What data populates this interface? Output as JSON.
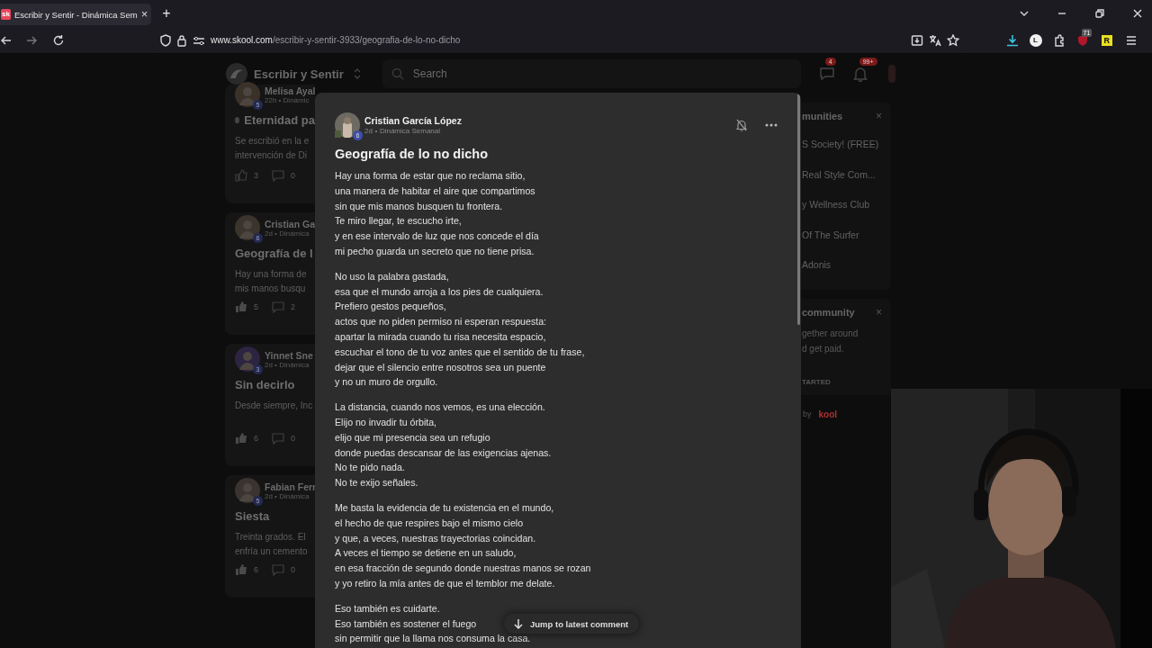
{
  "browser": {
    "tab": {
      "favicon": "sk",
      "title": "Escribir y Sentir - Dinámica Sem",
      "close": "×"
    },
    "new_tab": "+",
    "url": {
      "host": "www.skool.com",
      "path": "/escribir-y-sentir-3933/geografia-de-lo-no-dicho"
    },
    "extension_badge": "71",
    "extension_letter": "R",
    "profile_letter": "L"
  },
  "header": {
    "community": "Escribir y Sentir",
    "search_placeholder": "Search",
    "chat_badge": "4",
    "notification_badge": "99+"
  },
  "feed": [
    {
      "author": "Melisa Ayal",
      "level": "5",
      "meta": "22h • Dinámic",
      "pinned": true,
      "title": "Eternidad pa",
      "excerpt": [
        "Se escribió en la e",
        "intervención de Di"
      ],
      "likes": "3",
      "comments": "0",
      "liked": false
    },
    {
      "author": "Cristian Ga",
      "level": "6",
      "meta": "2d • Dinámica",
      "pinned": false,
      "title": "Geografía de l",
      "excerpt": [
        "Hay una forma de",
        "mis manos busqu"
      ],
      "likes": "5",
      "comments": "2",
      "liked": true
    },
    {
      "author": "Yinnet Sne",
      "level": "3",
      "meta": "2d • Dinámica",
      "pinned": false,
      "title": "Sin decirlo",
      "excerpt": [
        "Desde siempre, Inc"
      ],
      "likes": "6",
      "comments": "0",
      "liked": true
    },
    {
      "author": "Fabian Ferr",
      "level": "5",
      "meta": "2d • Dinámica",
      "pinned": false,
      "title": "Siesta",
      "excerpt": [
        "Treinta grados. El",
        "enfría un cemento"
      ],
      "likes": "6",
      "comments": "0",
      "liked": true
    }
  ],
  "sidebar": [
    {
      "title": "munities",
      "close": "×",
      "items": [
        "S Society! (FREE)",
        "Real Style Com...",
        "y Wellness Club",
        "Of The Surfer",
        "Adonis"
      ]
    },
    {
      "title": "community",
      "close": "×",
      "lines": [
        "gether around",
        "d get paid."
      ],
      "action": "TARTED"
    }
  ],
  "footer": {
    "text": "by",
    "brand": "kool"
  },
  "post": {
    "author": "Cristian García López",
    "level": "6",
    "time": "2d",
    "category": "Dinámica Semanal",
    "title": "Geografía de lo no dicho",
    "stanzas": [
      [
        "Hay una forma de estar que no reclama sitio,",
        "una manera de habitar el aire que compartimos",
        "sin que mis manos busquen tu frontera.",
        "Te miro llegar, te escucho irte,",
        "y en ese intervalo de luz que nos concede el día",
        "mi pecho guarda un secreto que no tiene prisa."
      ],
      [
        "No uso la palabra gastada,",
        "esa que el mundo arroja a los pies de cualquiera.",
        "Prefiero gestos pequeños,",
        "actos que no piden permiso ni esperan respuesta:",
        "apartar la mirada cuando tu risa necesita espacio,",
        "escuchar el tono de tu voz antes que el sentido de tu frase,",
        "dejar que el silencio entre nosotros sea un puente",
        "y no un muro de orgullo."
      ],
      [
        "La distancia, cuando nos vemos, es una elección.",
        "Elijo no invadir tu órbita,",
        "elijo que mi presencia sea un refugio",
        "donde puedas descansar de las exigencias ajenas.",
        "No te pido nada.",
        "No te exijo señales."
      ],
      [
        "Me basta la evidencia de tu existencia en el mundo,",
        "el hecho de que respires bajo el mismo cielo",
        "y que, a veces, nuestras trayectorias coincidan.",
        "A veces el tiempo se detiene en un saludo,",
        "en esa fracción de segundo donde nuestras manos se rozan",
        "y yo retiro la mía antes de que el temblor me delate."
      ],
      [
        "Eso también es cuidarte.",
        "Eso también es sostener el fuego",
        "sin permitir que la llama nos consuma la casa."
      ]
    ]
  },
  "jump_button": "Jump to latest comment"
}
